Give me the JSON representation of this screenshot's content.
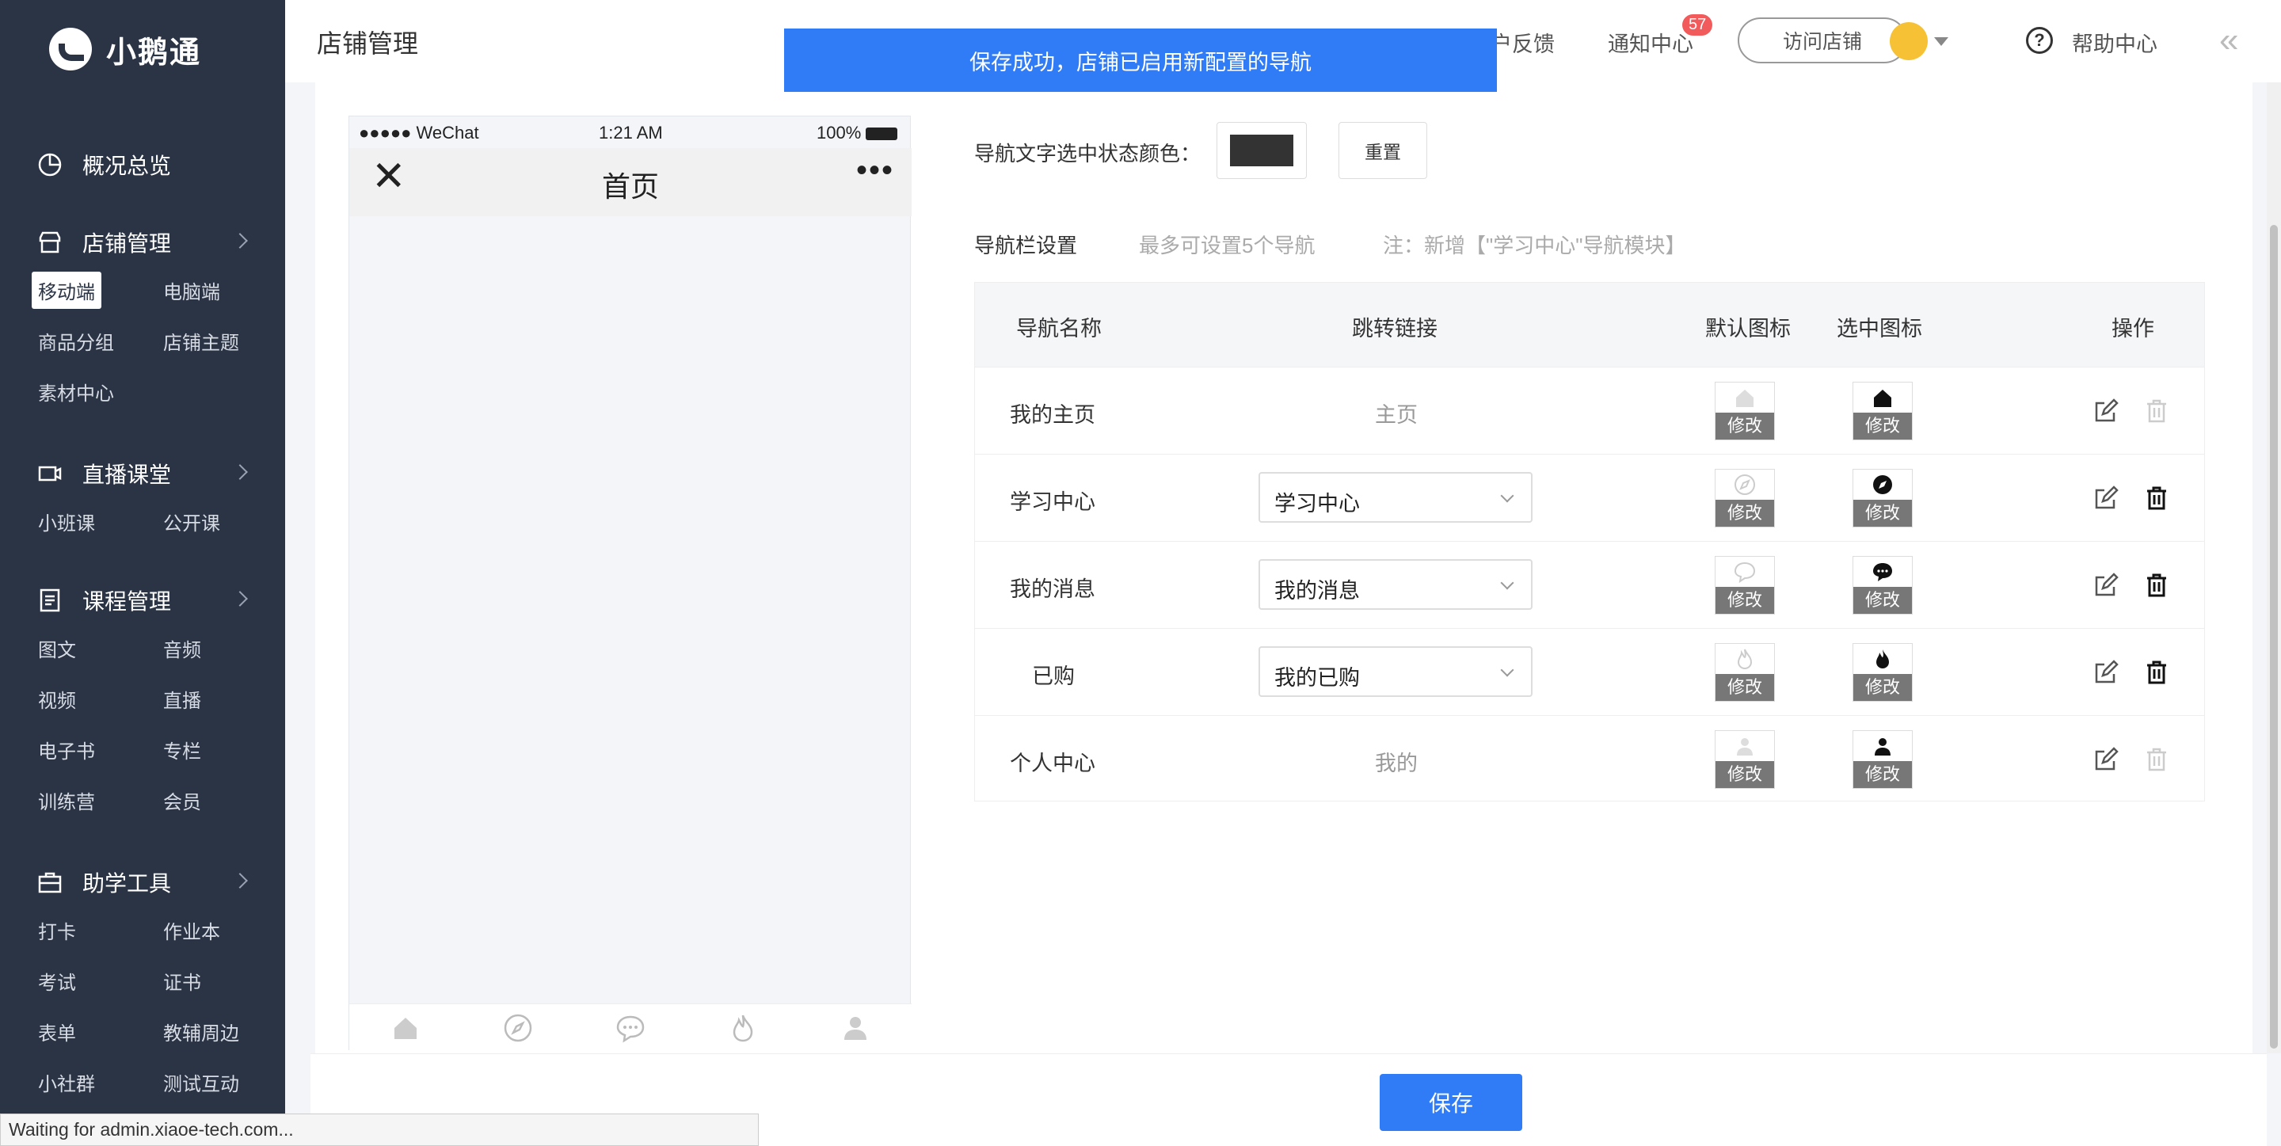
{
  "brand": {
    "name": "小鹅通"
  },
  "sidebar": {
    "groups": [
      {
        "label": "概况总览",
        "icon": "pie-chart-icon",
        "items": []
      },
      {
        "label": "店铺管理",
        "icon": "store-icon",
        "items": [
          "移动端",
          "电脑端",
          "商品分组",
          "店铺主题",
          "素材中心"
        ]
      },
      {
        "label": "直播课堂",
        "icon": "video-icon",
        "items": [
          "小班课",
          "公开课"
        ]
      },
      {
        "label": "课程管理",
        "icon": "document-icon",
        "items": [
          "图文",
          "音频",
          "视频",
          "直播",
          "电子书",
          "专栏",
          "训练营",
          "会员"
        ]
      },
      {
        "label": "助学工具",
        "icon": "toolbox-icon",
        "items": [
          "打卡",
          "作业本",
          "考试",
          "证书",
          "表单",
          "教辅周边",
          "小社群",
          "测试互动"
        ]
      }
    ],
    "active_item": "移动端"
  },
  "header": {
    "title": "店铺管理",
    "feedback": "户反馈",
    "notice": "通知中心",
    "notice_count": "57",
    "visit": "访问店铺",
    "help": "帮助中心"
  },
  "toast": {
    "message": "保存成功，店铺已启用新配置的导航"
  },
  "phone": {
    "carrier": "●●●●● WeChat",
    "time": "1:21 AM",
    "battery": "100%",
    "title": "首页",
    "close": "✕",
    "more": "•••"
  },
  "settings": {
    "color_label": "导航文字选中状态颜色：",
    "selected_color": "#333333",
    "reset": "重置",
    "navbar_label": "导航栏设置",
    "max_hint": "最多可设置5个导航",
    "note": "注：新增【\"学习中心\"导航模块】"
  },
  "table": {
    "headers": [
      "导航名称",
      "跳转链接",
      "默认图标",
      "选中图标",
      "操作"
    ],
    "modify_label": "修改",
    "rows": [
      {
        "name": "我的主页",
        "link": "主页",
        "link_type": "text",
        "icon": "home-icon",
        "deletable": false
      },
      {
        "name": "学习中心",
        "link": "学习中心",
        "link_type": "select",
        "icon": "compass-icon",
        "deletable": true
      },
      {
        "name": "我的消息",
        "link": "我的消息",
        "link_type": "select",
        "icon": "chat-icon",
        "deletable": true
      },
      {
        "name": "已购",
        "link": "我的已购",
        "link_type": "select",
        "icon": "fire-icon",
        "deletable": true
      },
      {
        "name": "个人中心",
        "link": "我的",
        "link_type": "text",
        "icon": "user-icon",
        "deletable": false
      }
    ]
  },
  "footer": {
    "save": "保存"
  },
  "browser_status": "Waiting for admin.xiaoe-tech.com..."
}
